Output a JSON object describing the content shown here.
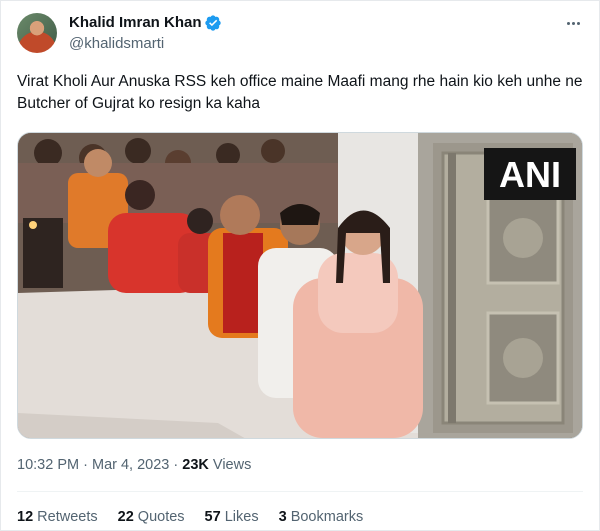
{
  "author": {
    "name": "Khalid Imran Khan",
    "handle": "@khalidsmarti"
  },
  "tweet": {
    "text": "Virat Kholi Aur Anuska RSS keh office maine Maafi mang rhe hain kio keh unhe ne Butcher of Gujrat ko resign ka kaha",
    "watermark": "ANI"
  },
  "meta": {
    "time": "10:32 PM",
    "sep1": "·",
    "date": "Mar 4, 2023",
    "sep2": "·",
    "views_count": "23K",
    "views_label": "Views"
  },
  "stats": {
    "retweets": {
      "num": "12",
      "label": "Retweets"
    },
    "quotes": {
      "num": "22",
      "label": "Quotes"
    },
    "likes": {
      "num": "57",
      "label": "Likes"
    },
    "bookmarks": {
      "num": "3",
      "label": "Bookmarks"
    }
  },
  "colors": {
    "verified": "#1d9bf0",
    "secondary_text": "#536471",
    "primary_text": "#0f1419"
  }
}
